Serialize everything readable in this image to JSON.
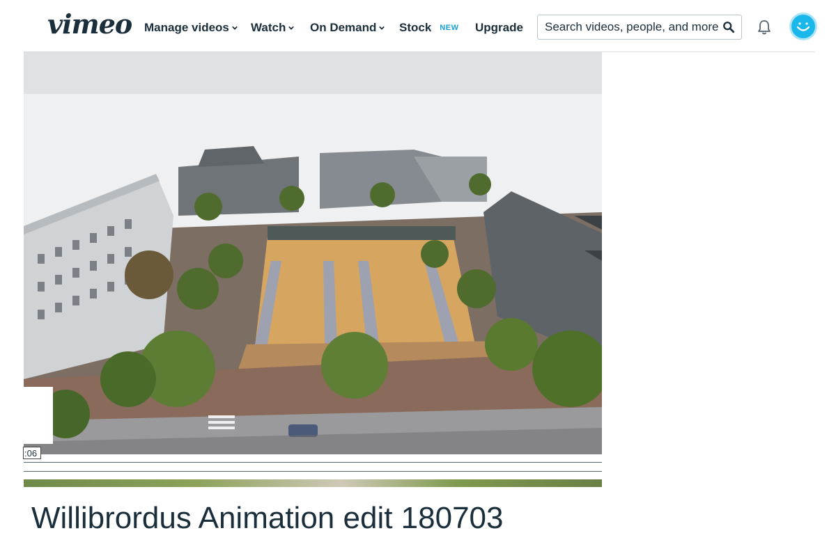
{
  "header": {
    "logo": "vimeo",
    "nav": [
      {
        "label": "Manage videos",
        "has_dropdown": true
      },
      {
        "label": "Watch",
        "has_dropdown": true
      },
      {
        "label": "On Demand",
        "has_dropdown": true
      },
      {
        "label": "Stock",
        "badge": "NEW"
      },
      {
        "label": "Upgrade"
      }
    ],
    "search": {
      "placeholder": "Search videos, people, and more",
      "icon": "search-icon"
    },
    "icons": {
      "notifications": "bell-icon",
      "avatar": "avatar"
    },
    "colors": {
      "text": "#1a2e3b",
      "accent": "#17a0d6",
      "avatar": "#1ab7ea"
    }
  },
  "player": {
    "timecode": ":06"
  },
  "video": {
    "title": "Willibrordus Animation edit 180703"
  }
}
